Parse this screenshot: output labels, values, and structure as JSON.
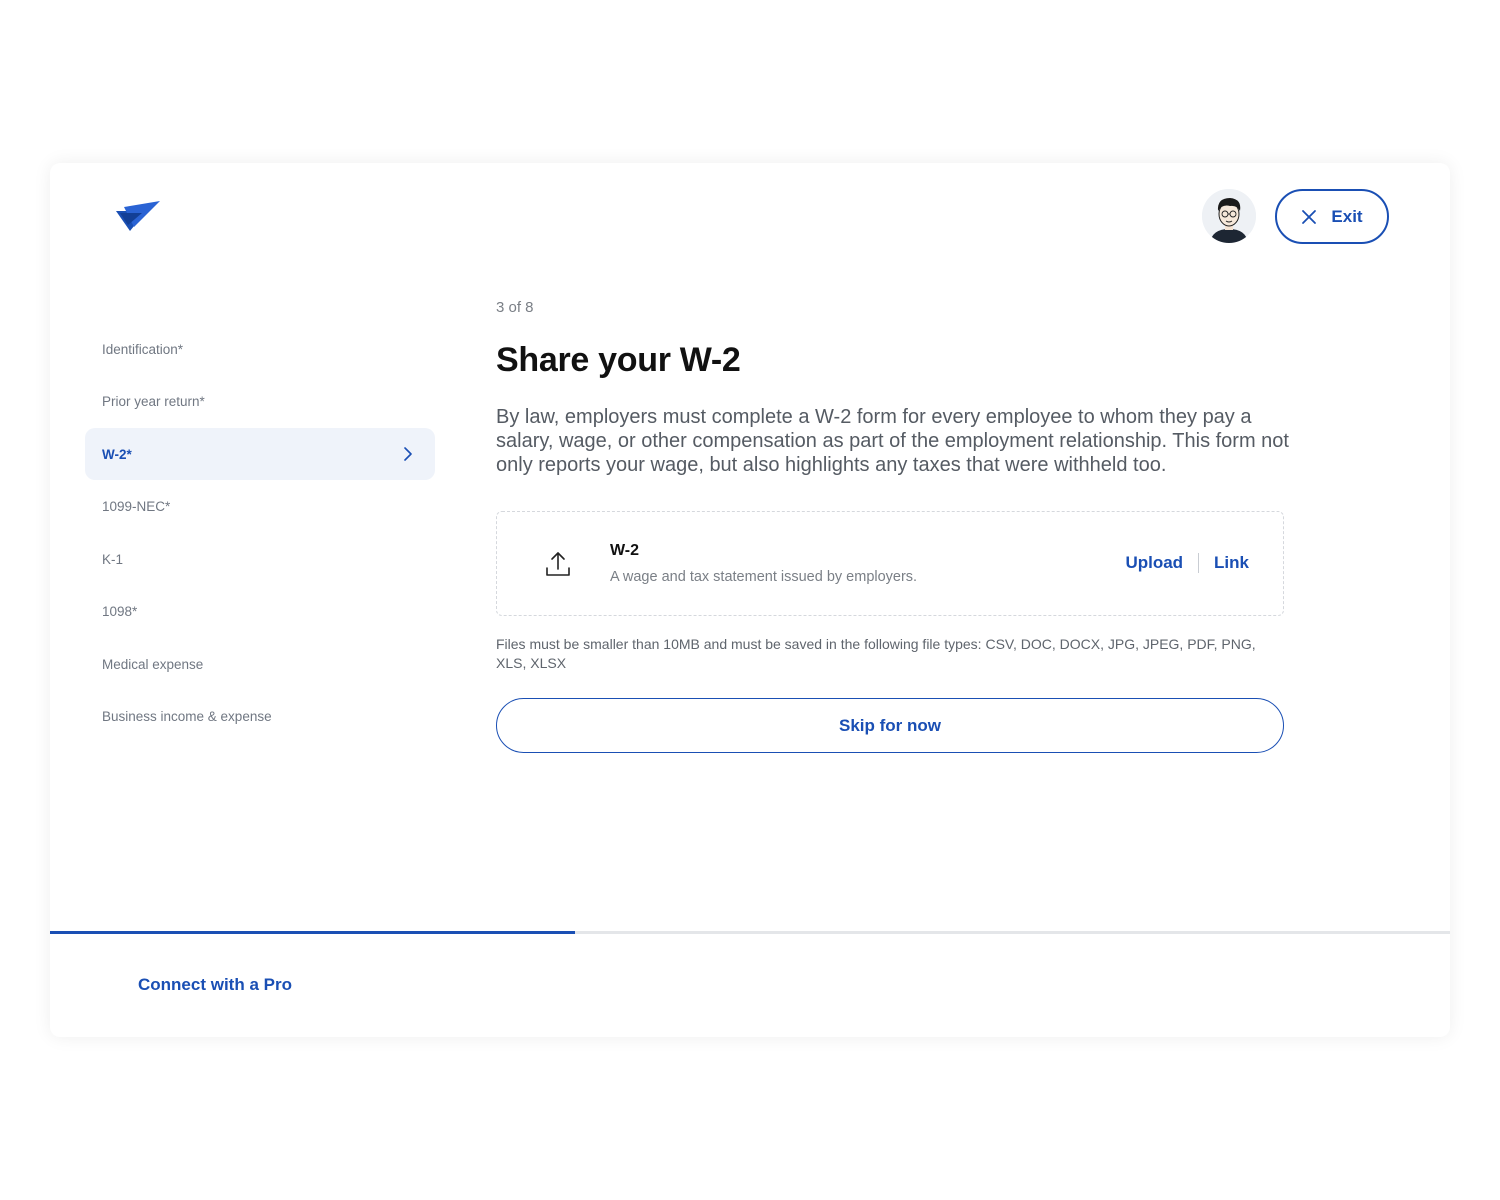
{
  "brand": {
    "accent": "#1a4fb4"
  },
  "header": {
    "exit_label": "Exit"
  },
  "sidebar": {
    "items": [
      {
        "label": "Identification*",
        "active": false
      },
      {
        "label": "Prior year return*",
        "active": false
      },
      {
        "label": "W-2*",
        "active": true
      },
      {
        "label": "1099-NEC*",
        "active": false
      },
      {
        "label": "K-1",
        "active": false
      },
      {
        "label": "1098*",
        "active": false
      },
      {
        "label": "Medical expense",
        "active": false
      },
      {
        "label": "Business income & expense",
        "active": false
      }
    ]
  },
  "main": {
    "step": "3 of 8",
    "title": "Share your W-2",
    "description": "By law, employers must complete a W-2 form for every employee to whom they pay a salary, wage, or other compensation as part of the employment relationship. This form not only reports your wage, but also highlights any taxes that were withheld too.",
    "document": {
      "name": "W-2",
      "description": "A wage and tax statement issued by employers.",
      "upload_label": "Upload",
      "link_label": "Link",
      "icon": "upload-icon"
    },
    "file_note": "Files must be smaller than 10MB and must be saved in the following file types: CSV, DOC, DOCX, JPG, JPEG, PDF, PNG, XLS, XLSX",
    "skip_label": "Skip for now"
  },
  "progress": {
    "fraction": 0.375
  },
  "footer": {
    "connect_label": "Connect with a Pro"
  }
}
